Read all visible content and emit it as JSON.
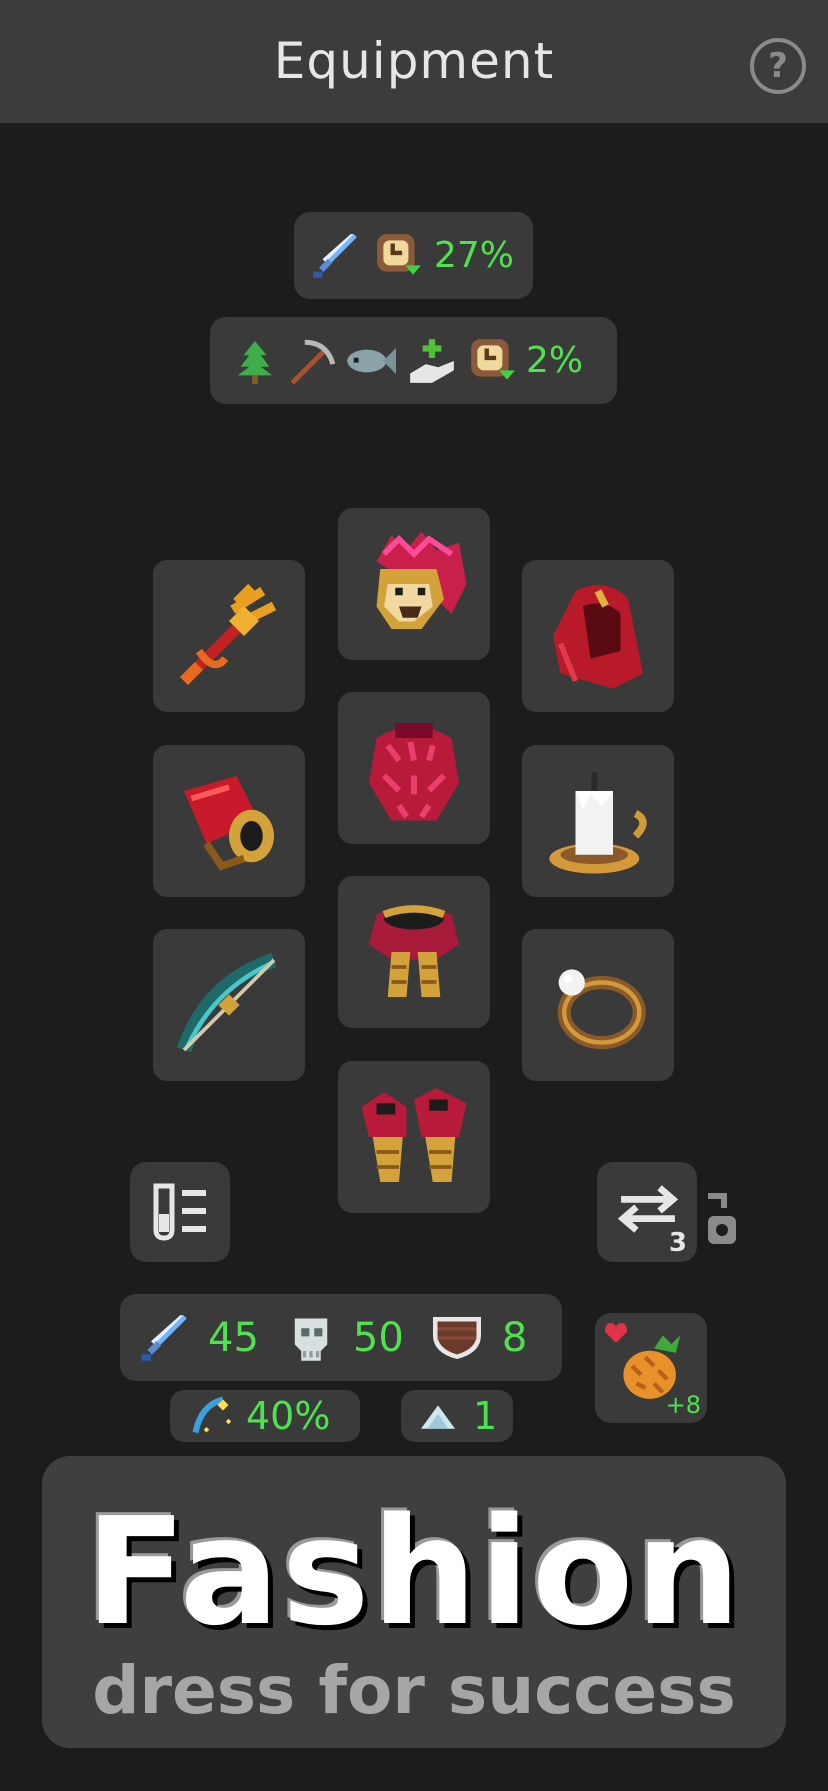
{
  "header": {
    "title": "Equipment",
    "help_label": "?"
  },
  "buffs": [
    {
      "icons": [
        "sword-icon",
        "clock-down-icon"
      ],
      "value": "27%"
    },
    {
      "icons": [
        "tree-icon",
        "pickaxe-icon",
        "fish-icon",
        "hand-plus-icon",
        "clock-down-icon"
      ],
      "value": "2%"
    }
  ],
  "slots": [
    {
      "id": "weapon",
      "item": "golden-trident-icon"
    },
    {
      "id": "head",
      "item": "lion-headdress-icon"
    },
    {
      "id": "cape",
      "item": "red-hood-icon"
    },
    {
      "id": "gloves",
      "item": "red-gauntlet-icon"
    },
    {
      "id": "body",
      "item": "red-feather-chest-icon"
    },
    {
      "id": "trinket",
      "item": "candle-icon"
    },
    {
      "id": "ranged",
      "item": "bow-icon"
    },
    {
      "id": "legs",
      "item": "feather-legs-icon"
    },
    {
      "id": "ring",
      "item": "pearl-ring-icon"
    },
    {
      "id": "boots",
      "item": "feather-boots-icon"
    }
  ],
  "swap": {
    "count": "3"
  },
  "stats": {
    "attack": "45",
    "defense": "50",
    "armor": "8",
    "crit": "40%",
    "level": "1"
  },
  "food": {
    "bonus": "+8"
  },
  "banner": {
    "title": "Fashion",
    "subtitle": "dress for success"
  },
  "colors": {
    "accent_green": "#4fe24f",
    "panel": "#3a3a3a",
    "background": "#1c1c1c",
    "header": "#3c3c3c"
  }
}
